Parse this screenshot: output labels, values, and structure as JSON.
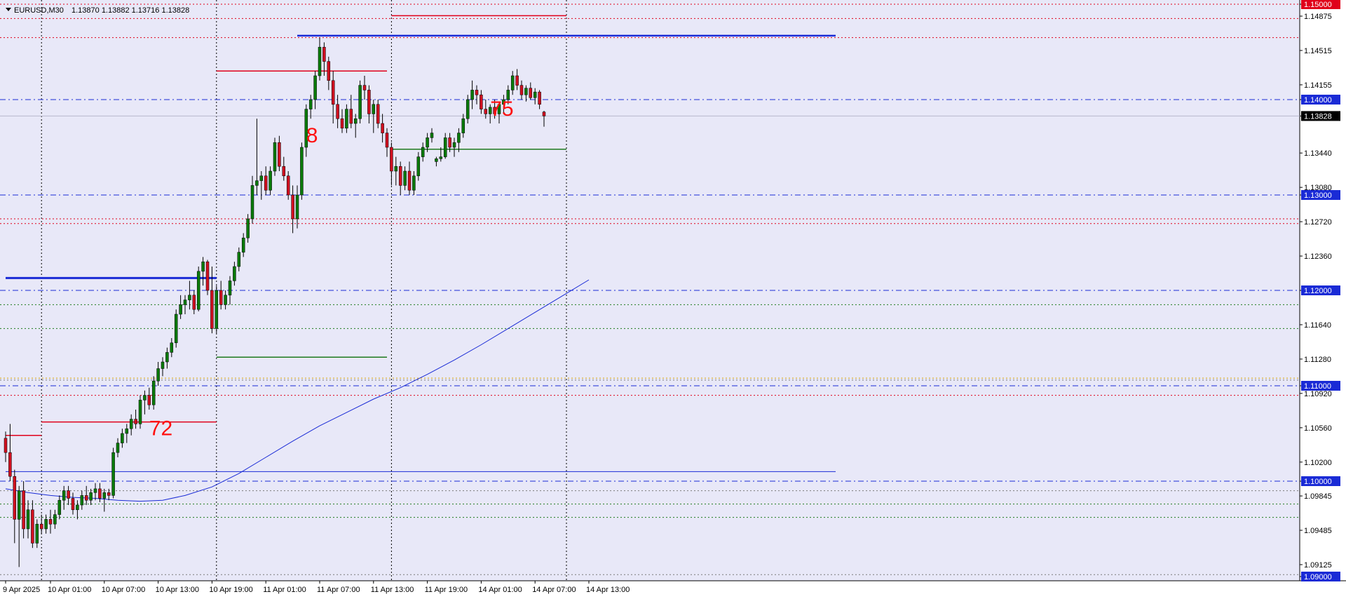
{
  "header": {
    "symbol": "EURUSD,M30",
    "ohlc": "1.13870 1.13882 1.13716 1.13828"
  },
  "chart_data": {
    "type": "candlestick",
    "symbol": "EURUSD",
    "timeframe": "M30",
    "ylim": [
      1.09,
      1.1516
    ],
    "y_ticks": [
      "1.15000",
      "1.14875",
      "1.14515",
      "1.14155",
      "1.14000",
      "1.13828",
      "1.13440",
      "1.13080",
      "1.13000",
      "1.12720",
      "1.12360",
      "1.12000",
      "1.11640",
      "1.11280",
      "1.11000",
      "1.10920",
      "1.10560",
      "1.10200",
      "1.10000",
      "1.09845",
      "1.09485",
      "1.09125",
      "1.09000"
    ],
    "y_ticks_highlight": {
      "1.15000": "#e0001a",
      "1.14000": "#1a2bd6",
      "1.13828": "#000000",
      "1.13000": "#1a2bd6",
      "1.12000": "#1a2bd6",
      "1.11000": "#1a2bd6",
      "1.10000": "#1a2bd6",
      "1.09000": "#1a2bd6"
    },
    "x_ticks": [
      {
        "label": "9 Apr 2025",
        "i": 0
      },
      {
        "label": "10 Apr 01:00",
        "i": 10
      },
      {
        "label": "10 Apr 07:00",
        "i": 22
      },
      {
        "label": "10 Apr 13:00",
        "i": 34
      },
      {
        "label": "10 Apr 19:00",
        "i": 46
      },
      {
        "label": "11 Apr 01:00",
        "i": 58
      },
      {
        "label": "11 Apr 07:00",
        "i": 70
      },
      {
        "label": "11 Apr 13:00",
        "i": 82
      },
      {
        "label": "11 Apr 19:00",
        "i": 94
      },
      {
        "label": "14 Apr 01:00",
        "i": 106
      },
      {
        "label": "14 Apr 07:00",
        "i": 118
      },
      {
        "label": "14 Apr 13:00",
        "i": 130
      }
    ],
    "candles": [
      [
        1.1045,
        1.1052,
        1.102,
        1.103
      ],
      [
        1.103,
        1.106,
        1.1,
        1.1005
      ],
      [
        1.1005,
        1.1012,
        1.0935,
        1.096
      ],
      [
        1.096,
        1.0995,
        1.091,
        1.099
      ],
      [
        1.099,
        1.1,
        1.094,
        1.095
      ],
      [
        1.095,
        1.098,
        1.094,
        1.097
      ],
      [
        1.097,
        1.098,
        1.093,
        1.0935
      ],
      [
        1.0935,
        1.096,
        1.093,
        1.0955
      ],
      [
        1.0955,
        1.0965,
        1.0945,
        1.095
      ],
      [
        1.095,
        1.0965,
        1.0945,
        1.096
      ],
      [
        1.096,
        1.097,
        1.0945,
        1.0955
      ],
      [
        1.0955,
        1.097,
        1.095,
        1.0965
      ],
      [
        1.0965,
        1.0985,
        1.096,
        1.098
      ],
      [
        1.098,
        1.0995,
        1.097,
        1.099
      ],
      [
        1.099,
        1.0995,
        1.0975,
        1.0982
      ],
      [
        1.0982,
        1.0988,
        1.0965,
        1.097
      ],
      [
        1.097,
        1.098,
        1.096,
        1.0975
      ],
      [
        1.0975,
        1.099,
        1.097,
        1.0985
      ],
      [
        1.0985,
        1.0995,
        1.0975,
        1.098
      ],
      [
        1.098,
        1.0992,
        1.0975,
        1.0988
      ],
      [
        1.0988,
        1.0998,
        1.098,
        1.0992
      ],
      [
        1.0992,
        1.0998,
        1.0978,
        1.0982
      ],
      [
        1.0982,
        1.0992,
        1.0968,
        1.0988
      ],
      [
        1.0988,
        1.0992,
        1.098,
        1.0985
      ],
      [
        1.0985,
        1.1035,
        1.0982,
        1.103
      ],
      [
        1.103,
        1.1045,
        1.1025,
        1.104
      ],
      [
        1.104,
        1.1055,
        1.1035,
        1.105
      ],
      [
        1.105,
        1.106,
        1.104,
        1.1055
      ],
      [
        1.1055,
        1.107,
        1.1048,
        1.1065
      ],
      [
        1.1065,
        1.1075,
        1.1055,
        1.106
      ],
      [
        1.106,
        1.109,
        1.1055,
        1.1085
      ],
      [
        1.1085,
        1.1095,
        1.107,
        1.109
      ],
      [
        1.109,
        1.1098,
        1.1075,
        1.108
      ],
      [
        1.108,
        1.111,
        1.1075,
        1.1105
      ],
      [
        1.1105,
        1.1125,
        1.11,
        1.1118
      ],
      [
        1.1118,
        1.113,
        1.111,
        1.1125
      ],
      [
        1.1125,
        1.114,
        1.1118,
        1.1135
      ],
      [
        1.1135,
        1.115,
        1.113,
        1.1145
      ],
      [
        1.1145,
        1.118,
        1.114,
        1.1175
      ],
      [
        1.1175,
        1.1195,
        1.117,
        1.1185
      ],
      [
        1.1185,
        1.1195,
        1.1175,
        1.119
      ],
      [
        1.119,
        1.121,
        1.118,
        1.1195
      ],
      [
        1.1195,
        1.12,
        1.1175,
        1.118
      ],
      [
        1.118,
        1.1225,
        1.1178,
        1.122
      ],
      [
        1.122,
        1.1235,
        1.1205,
        1.123
      ],
      [
        1.123,
        1.1232,
        1.1195,
        1.12
      ],
      [
        1.12,
        1.1225,
        1.1155,
        1.116
      ],
      [
        1.116,
        1.1205,
        1.1155,
        1.12
      ],
      [
        1.12,
        1.121,
        1.118,
        1.1185
      ],
      [
        1.1185,
        1.12,
        1.118,
        1.1195
      ],
      [
        1.1195,
        1.1215,
        1.1185,
        1.121
      ],
      [
        1.121,
        1.123,
        1.1205,
        1.1225
      ],
      [
        1.1225,
        1.1245,
        1.122,
        1.124
      ],
      [
        1.124,
        1.126,
        1.1235,
        1.1255
      ],
      [
        1.1255,
        1.128,
        1.125,
        1.1275
      ],
      [
        1.1275,
        1.132,
        1.127,
        1.131
      ],
      [
        1.131,
        1.138,
        1.13,
        1.1315
      ],
      [
        1.1315,
        1.1325,
        1.1295,
        1.132
      ],
      [
        1.132,
        1.133,
        1.13,
        1.1305
      ],
      [
        1.1305,
        1.133,
        1.13,
        1.1325
      ],
      [
        1.1325,
        1.136,
        1.132,
        1.1355
      ],
      [
        1.1355,
        1.1362,
        1.1325,
        1.133
      ],
      [
        1.133,
        1.134,
        1.1315,
        1.132
      ],
      [
        1.132,
        1.1325,
        1.1295,
        1.13
      ],
      [
        1.13,
        1.131,
        1.126,
        1.1275
      ],
      [
        1.1275,
        1.131,
        1.1265,
        1.13
      ],
      [
        1.13,
        1.1355,
        1.1295,
        1.135
      ],
      [
        1.135,
        1.1395,
        1.134,
        1.139
      ],
      [
        1.139,
        1.1405,
        1.138,
        1.14
      ],
      [
        1.14,
        1.143,
        1.139,
        1.1425
      ],
      [
        1.1425,
        1.1465,
        1.142,
        1.1455
      ],
      [
        1.1455,
        1.146,
        1.1425,
        1.144
      ],
      [
        1.144,
        1.1445,
        1.141,
        1.142
      ],
      [
        1.142,
        1.143,
        1.1375,
        1.1395
      ],
      [
        1.1395,
        1.1405,
        1.137,
        1.138
      ],
      [
        1.138,
        1.139,
        1.1365,
        1.137
      ],
      [
        1.137,
        1.1395,
        1.1365,
        1.139
      ],
      [
        1.139,
        1.1405,
        1.137,
        1.1375
      ],
      [
        1.1375,
        1.1385,
        1.136,
        1.138
      ],
      [
        1.138,
        1.142,
        1.1375,
        1.1415
      ],
      [
        1.1415,
        1.1425,
        1.14,
        1.141
      ],
      [
        1.141,
        1.1415,
        1.1375,
        1.1385
      ],
      [
        1.1385,
        1.14,
        1.1365,
        1.1395
      ],
      [
        1.1395,
        1.14,
        1.137,
        1.1375
      ],
      [
        1.1375,
        1.1385,
        1.1355,
        1.1365
      ],
      [
        1.1365,
        1.137,
        1.134,
        1.135
      ],
      [
        1.135,
        1.1355,
        1.131,
        1.1325
      ],
      [
        1.1325,
        1.134,
        1.131,
        1.133
      ],
      [
        1.133,
        1.1335,
        1.13,
        1.131
      ],
      [
        1.131,
        1.133,
        1.1305,
        1.1325
      ],
      [
        1.1325,
        1.1335,
        1.13,
        1.1305
      ],
      [
        1.1305,
        1.1325,
        1.13,
        1.132
      ],
      [
        1.132,
        1.1345,
        1.1315,
        1.134
      ],
      [
        1.134,
        1.1355,
        1.1335,
        1.135
      ],
      [
        1.135,
        1.1365,
        1.1345,
        1.136
      ],
      [
        1.136,
        1.137,
        1.1355,
        1.1365
      ],
      [
        1.1335,
        1.134,
        1.133,
        1.1338
      ],
      [
        1.1338,
        1.135,
        1.1335,
        1.134
      ],
      [
        1.134,
        1.1365,
        1.1338,
        1.136
      ],
      [
        1.136,
        1.1365,
        1.1345,
        1.135
      ],
      [
        1.135,
        1.136,
        1.134,
        1.1355
      ],
      [
        1.1355,
        1.137,
        1.1345,
        1.1365
      ],
      [
        1.1365,
        1.1385,
        1.136,
        1.138
      ],
      [
        1.138,
        1.1405,
        1.1375,
        1.14
      ],
      [
        1.14,
        1.142,
        1.139,
        1.141
      ],
      [
        1.141,
        1.1415,
        1.1395,
        1.1405
      ],
      [
        1.1405,
        1.141,
        1.1385,
        1.139
      ],
      [
        1.139,
        1.14,
        1.138,
        1.1385
      ],
      [
        1.1385,
        1.1395,
        1.1375,
        1.1392
      ],
      [
        1.1392,
        1.14,
        1.138,
        1.1385
      ],
      [
        1.1385,
        1.1398,
        1.1375,
        1.1395
      ],
      [
        1.1395,
        1.1405,
        1.1385,
        1.14
      ],
      [
        1.14,
        1.1415,
        1.1395,
        1.141
      ],
      [
        1.141,
        1.143,
        1.1405,
        1.1425
      ],
      [
        1.1425,
        1.1432,
        1.141,
        1.1415
      ],
      [
        1.1415,
        1.142,
        1.14,
        1.1405
      ],
      [
        1.1405,
        1.1415,
        1.1398,
        1.1412
      ],
      [
        1.1412,
        1.1418,
        1.14,
        1.1402
      ],
      [
        1.1402,
        1.1412,
        1.1395,
        1.1408
      ],
      [
        1.1408,
        1.141,
        1.139,
        1.1395
      ],
      [
        1.1387,
        1.13882,
        1.13716,
        1.13828
      ]
    ],
    "ma": [
      [
        0,
        1.0992
      ],
      [
        5,
        1.0988
      ],
      [
        10,
        1.0985
      ],
      [
        15,
        1.0983
      ],
      [
        20,
        1.0982
      ],
      [
        25,
        1.098
      ],
      [
        30,
        1.0979
      ],
      [
        35,
        1.098
      ],
      [
        40,
        1.0985
      ],
      [
        46,
        1.0994
      ],
      [
        52,
        1.1008
      ],
      [
        58,
        1.1025
      ],
      [
        64,
        1.1042
      ],
      [
        70,
        1.1058
      ],
      [
        76,
        1.1072
      ],
      [
        82,
        1.1086
      ],
      [
        88,
        1.1098
      ],
      [
        94,
        1.1112
      ],
      [
        100,
        1.1127
      ],
      [
        106,
        1.1143
      ],
      [
        112,
        1.116
      ],
      [
        118,
        1.1177
      ],
      [
        124,
        1.1194
      ],
      [
        130,
        1.1211
      ]
    ],
    "levels": [
      {
        "price": 1.15,
        "color": "#e0001a",
        "style": "dotted"
      },
      {
        "price": 1.1485,
        "color": "#e0001a",
        "style": "dotted"
      },
      {
        "price": 1.1465,
        "color": "#e0001a",
        "style": "dotted"
      },
      {
        "price": 1.14,
        "color": "#1a2bd6",
        "style": "dashdot"
      },
      {
        "price": 1.13828,
        "color": "#b8b8cc",
        "style": "solid"
      },
      {
        "price": 1.13,
        "color": "#1a2bd6",
        "style": "dashdot"
      },
      {
        "price": 1.1275,
        "color": "#e0001a",
        "style": "dotted"
      },
      {
        "price": 1.127,
        "color": "#e0001a",
        "style": "dotted"
      },
      {
        "price": 1.12,
        "color": "#1a2bd6",
        "style": "dashdot"
      },
      {
        "price": 1.1185,
        "color": "#1e7a1e",
        "style": "dotted"
      },
      {
        "price": 1.116,
        "color": "#1e7a1e",
        "style": "dotted"
      },
      {
        "price": 1.1108,
        "color": "#d8a200",
        "style": "dotted"
      },
      {
        "price": 1.1106,
        "color": "#7a7a7a",
        "style": "dotted"
      },
      {
        "price": 1.11,
        "color": "#1a2bd6",
        "style": "dashdot"
      },
      {
        "price": 1.109,
        "color": "#e0001a",
        "style": "dotted"
      },
      {
        "price": 1.1,
        "color": "#1a2bd6",
        "style": "dashdot"
      },
      {
        "price": 1.099,
        "color": "#7a7a7a",
        "style": "dotted"
      },
      {
        "price": 1.0976,
        "color": "#1e7a1e",
        "style": "dotted"
      },
      {
        "price": 1.0962,
        "color": "#1e7a1e",
        "style": "dotted"
      },
      {
        "price": 1.0902,
        "color": "#7a7a7a",
        "style": "dotted"
      }
    ],
    "segments": [
      {
        "from": 0,
        "to": 8,
        "price": 1.1048,
        "color": "#e0001a",
        "width": 1.5
      },
      {
        "from": 8,
        "to": 47,
        "price": 1.1062,
        "color": "#e0001a",
        "width": 1.5
      },
      {
        "from": 47,
        "to": 85,
        "price": 1.143,
        "color": "#e0001a",
        "width": 1.5
      },
      {
        "from": 86,
        "to": 125,
        "price": 1.1488,
        "color": "#e0001a",
        "width": 1.5
      },
      {
        "from": 65,
        "to": 185,
        "price": 1.1467,
        "color": "#1a2bd6",
        "width": 2.5
      },
      {
        "from": 0,
        "to": 47,
        "price": 1.1213,
        "color": "#1a2bd6",
        "width": 3
      },
      {
        "from": 47,
        "to": 85,
        "price": 1.113,
        "color": "#1e7a1e",
        "width": 1.5
      },
      {
        "from": 86,
        "to": 125,
        "price": 1.1348,
        "color": "#1e7a1e",
        "width": 1.5
      },
      {
        "from": 0,
        "to": 185,
        "price": 1.101,
        "color": "#1a2bd6",
        "width": 1
      }
    ],
    "vlines": [
      8,
      47,
      86,
      125
    ],
    "annotations": [
      {
        "text": "72",
        "i": 32,
        "price": 1.1048
      },
      {
        "text": "8",
        "i": 67,
        "price": 1.1355
      },
      {
        "text": "75",
        "i": 108,
        "price": 1.1383
      }
    ]
  }
}
